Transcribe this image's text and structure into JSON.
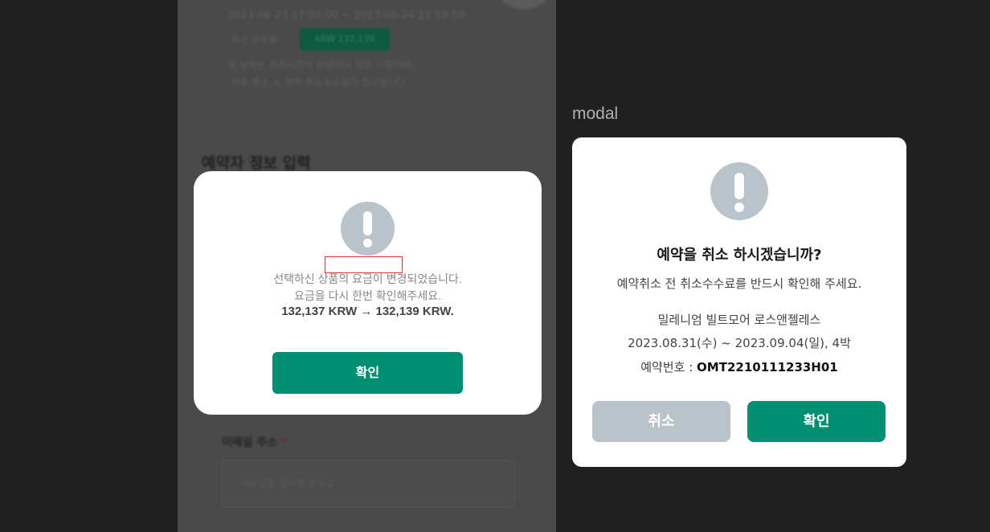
{
  "background": {
    "period": "2023-06-23 17:03:00 ~ 2023-06-24 23:59:59",
    "fee_label": "취소 수수료",
    "fee_badge": "KRW 132,139",
    "note1": "위 날짜는 현지시간이 반영되지 않은 기준이며,",
    "note2": "이후 취소 시 전액 취소수수료가 청구됩니다.",
    "section_heading": "예약자 정보 입력",
    "email_label": "이메일 주소",
    "required_mark": "*",
    "email_placeholder": "이메일을 입력해 주세요"
  },
  "left_modal": {
    "icon": "exclamation-icon",
    "line1": "선택하신 상품의 요금이 변경되었습니다.",
    "line2": "요금을 다시 한번 확인해주세요.",
    "line3": "132,137 KRW → 132,139 KRW.",
    "confirm_label": "확인"
  },
  "modal_label": "modal",
  "right_modal": {
    "icon": "exclamation-icon",
    "title": "예약을 취소 하시겠습니까?",
    "subtitle": "예약취소 전 취소수수료를 반드시 확인해 주세요.",
    "hotel": "밀레니엄 빌트모어 로스앤젤레스",
    "dates": "2023.08.31(수) ~ 2023.09.04(일), 4박",
    "booking_label": "예약번호 : ",
    "booking_code": "OMT2210111233H01",
    "cancel_label": "취소",
    "confirm_label": "확인"
  },
  "colors": {
    "accent": "#008f72",
    "icon_gray": "#b9c3ca",
    "highlight_border": "#e03030"
  }
}
